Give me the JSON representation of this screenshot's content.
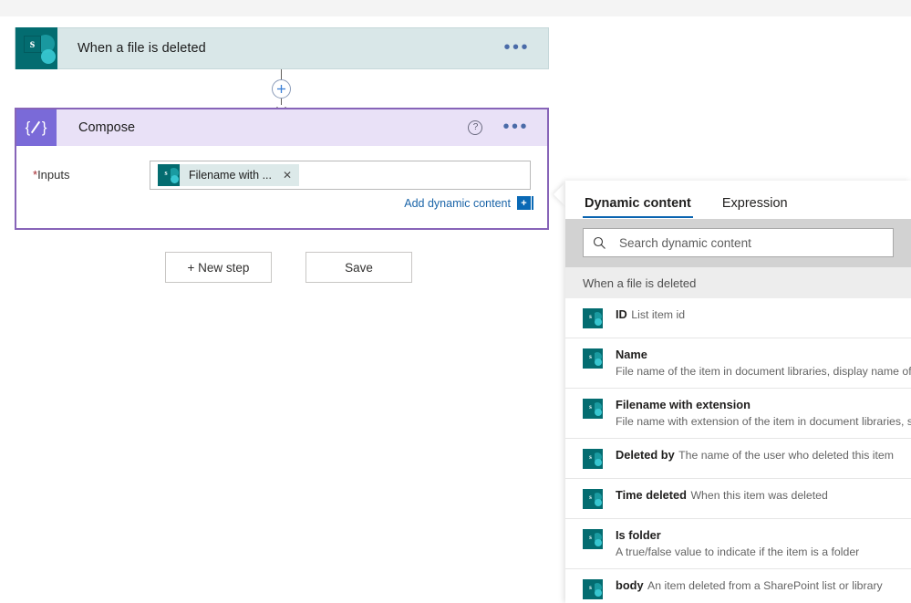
{
  "trigger": {
    "title": "When a file is deleted",
    "icon": "sharepoint-icon",
    "menu_label": "•••"
  },
  "connector": {
    "add_label": "+"
  },
  "compose": {
    "title": "Compose",
    "icon": "compose-braces-icon",
    "help_label": "?",
    "menu_label": "•••",
    "input_label": "Inputs",
    "required_marker": "*",
    "token": {
      "label": "Filename with ...",
      "close_label": "✕"
    },
    "add_dynamic_content": "Add dynamic content",
    "add_dynamic_icon_label": "+"
  },
  "actions": {
    "new_step": "+ New step",
    "save": "Save"
  },
  "dynamic_panel": {
    "tabs": [
      {
        "label": "Dynamic content",
        "active": true
      },
      {
        "label": "Expression",
        "active": false
      }
    ],
    "search": {
      "placeholder": "Search dynamic content",
      "value": "",
      "icon": "search-icon"
    },
    "group_header": "When a file is deleted",
    "items": [
      {
        "name": "ID",
        "description": "List item id",
        "icon": "sharepoint-icon"
      },
      {
        "name": "Name",
        "description": "File name of the item in document libraries, display name of …",
        "icon": "sharepoint-icon"
      },
      {
        "name": "Filename with extension",
        "description": "File name with extension of the item in document libraries, s…",
        "icon": "sharepoint-icon"
      },
      {
        "name": "Deleted by",
        "description": "The name of the user who deleted this item",
        "icon": "sharepoint-icon"
      },
      {
        "name": "Time deleted",
        "description": "When this item was deleted",
        "icon": "sharepoint-icon"
      },
      {
        "name": "Is folder",
        "description": "A true/false value to indicate if the item is a folder",
        "icon": "sharepoint-icon"
      },
      {
        "name": "body",
        "description": "An item deleted from a SharePoint list or library",
        "icon": "sharepoint-icon"
      }
    ]
  },
  "colors": {
    "sharepoint_teal": "#036c70",
    "compose_purple": "#7a6ad8",
    "compose_header": "#e9e1f7",
    "trigger_bg": "#d9e7e8",
    "accent_blue": "#0a64b0",
    "link_blue": "#1a64a8",
    "required_red": "#a4262c"
  }
}
